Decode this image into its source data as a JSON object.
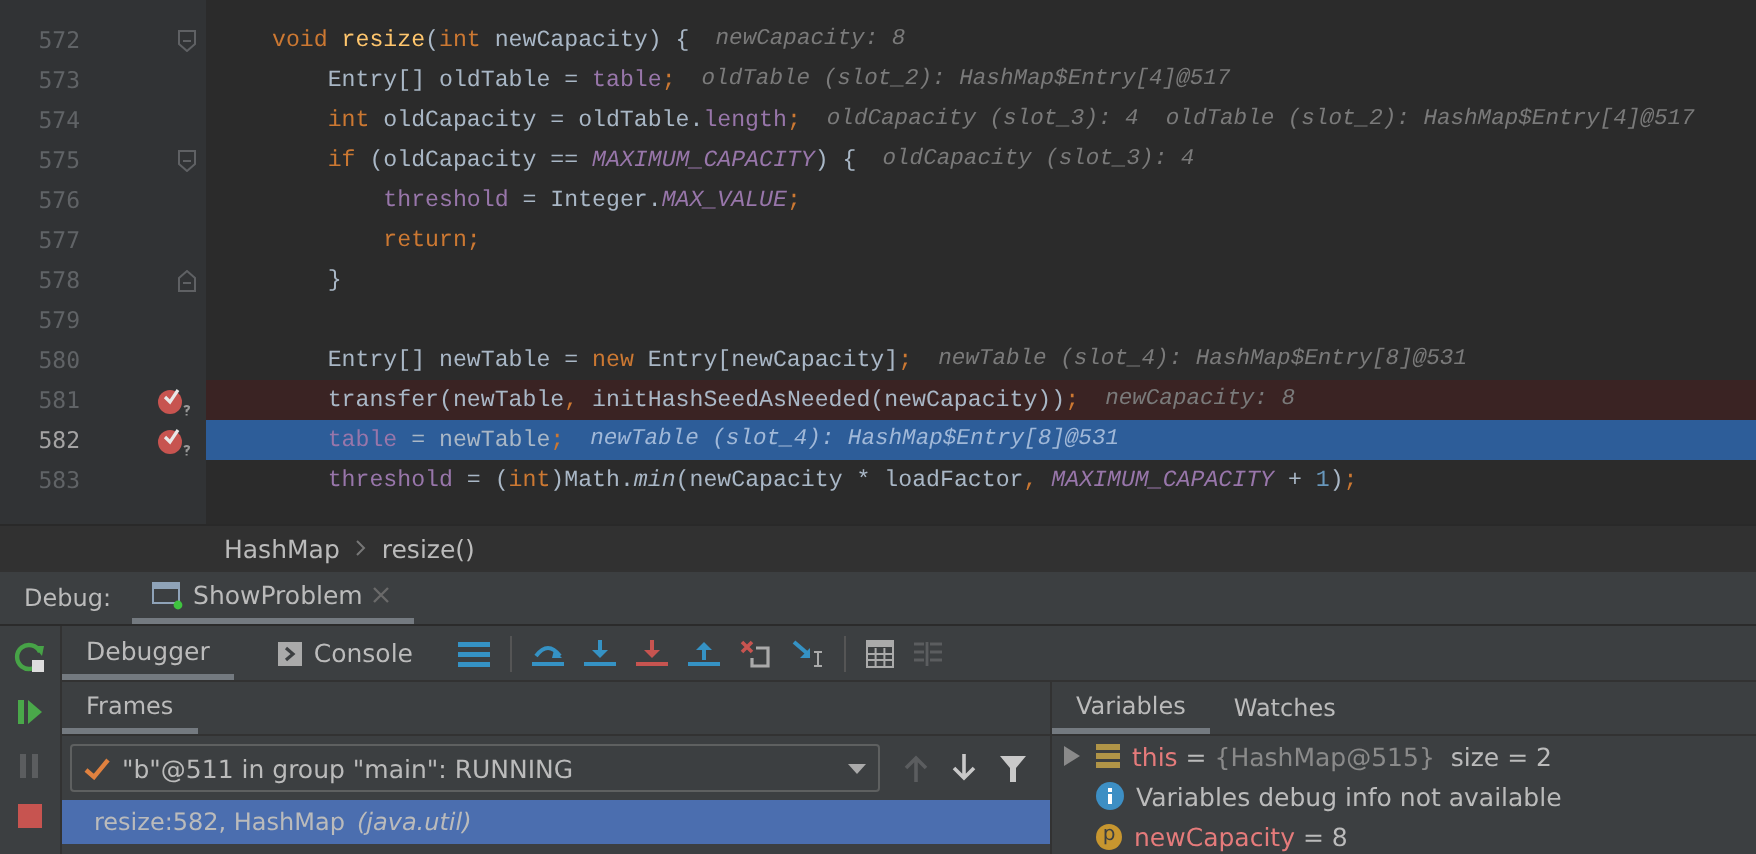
{
  "editor": {
    "lines": [
      {
        "number": "572",
        "fold_start": true,
        "fold_end": false,
        "breakpoint": false,
        "execution_point": false,
        "tokens": [
          {
            "kind": "kw",
            "text": "void"
          },
          {
            "kind": "decl",
            "text": " resize"
          },
          {
            "kind": "plain",
            "text": "("
          },
          {
            "kind": "kw",
            "text": "int"
          },
          {
            "kind": "plain",
            "text": " newCapacity) {"
          }
        ],
        "hint": "newCapacity: 8"
      },
      {
        "number": "573",
        "fold_start": false,
        "fold_end": false,
        "breakpoint": false,
        "execution_point": false,
        "tokens": [
          {
            "kind": "plain",
            "text": "    Entry[] oldTable = "
          },
          {
            "kind": "field",
            "text": "table"
          },
          {
            "kind": "kw",
            "text": ";"
          }
        ],
        "hint": "oldTable (slot_2): HashMap$Entry[4]@517"
      },
      {
        "number": "574",
        "fold_start": false,
        "fold_end": false,
        "breakpoint": false,
        "execution_point": false,
        "tokens": [
          {
            "kind": "kw",
            "text": "    int"
          },
          {
            "kind": "plain",
            "text": " oldCapacity = oldTable."
          },
          {
            "kind": "field",
            "text": "length"
          },
          {
            "kind": "kw",
            "text": ";"
          }
        ],
        "hint": "oldCapacity (slot_3): 4  oldTable (slot_2): HashMap$Entry[4]@517"
      },
      {
        "number": "575",
        "fold_start": true,
        "fold_end": false,
        "breakpoint": false,
        "execution_point": false,
        "tokens": [
          {
            "kind": "kw",
            "text": "    if"
          },
          {
            "kind": "plain",
            "text": " (oldCapacity == "
          },
          {
            "kind": "static",
            "text": "MAXIMUM_CAPACITY"
          },
          {
            "kind": "plain",
            "text": ") {"
          }
        ],
        "hint": "oldCapacity (slot_3): 4"
      },
      {
        "number": "576",
        "fold_start": false,
        "fold_end": false,
        "breakpoint": false,
        "execution_point": false,
        "tokens": [
          {
            "kind": "field",
            "text": "        threshold"
          },
          {
            "kind": "plain",
            "text": " = Integer."
          },
          {
            "kind": "static",
            "text": "MAX_VALUE"
          },
          {
            "kind": "kw",
            "text": ";"
          }
        ]
      },
      {
        "number": "577",
        "fold_start": false,
        "fold_end": false,
        "breakpoint": false,
        "execution_point": false,
        "tokens": [
          {
            "kind": "kw",
            "text": "        return;"
          }
        ]
      },
      {
        "number": "578",
        "fold_start": false,
        "fold_end": true,
        "breakpoint": false,
        "execution_point": false,
        "tokens": [
          {
            "kind": "plain",
            "text": "    }"
          }
        ]
      },
      {
        "number": "579",
        "fold_start": false,
        "fold_end": false,
        "breakpoint": false,
        "execution_point": false
      },
      {
        "number": "580",
        "fold_start": false,
        "fold_end": false,
        "breakpoint": false,
        "execution_point": false,
        "tokens": [
          {
            "kind": "plain",
            "text": "    Entry[] newTable = "
          },
          {
            "kind": "kw",
            "text": "new"
          },
          {
            "kind": "plain",
            "text": " Entry[newCapacity]"
          },
          {
            "kind": "kw",
            "text": ";"
          }
        ],
        "hint": "newTable (slot_4): HashMap$Entry[8]@531"
      },
      {
        "number": "581",
        "fold_start": false,
        "fold_end": false,
        "breakpoint": true,
        "execution_point": false,
        "tokens": [
          {
            "kind": "plain",
            "text": "    transfer(newTable"
          },
          {
            "kind": "kw",
            "text": ","
          },
          {
            "kind": "plain",
            "text": " initHashSeedAsNeeded(newCapacity))"
          },
          {
            "kind": "kw",
            "text": ";"
          }
        ],
        "hint": "newCapacity: 8"
      },
      {
        "number": "582",
        "fold_start": false,
        "fold_end": false,
        "breakpoint": true,
        "execution_point": true,
        "tokens": [
          {
            "kind": "field",
            "text": "    table"
          },
          {
            "kind": "plain",
            "text": " = newTable"
          },
          {
            "kind": "kw",
            "text": ";"
          }
        ],
        "hint": "newTable (slot_4): HashMap$Entry[8]@531"
      },
      {
        "number": "583",
        "fold_start": false,
        "fold_end": false,
        "breakpoint": false,
        "execution_point": false,
        "tokens": [
          {
            "kind": "field",
            "text": "    threshold"
          },
          {
            "kind": "plain",
            "text": " = ("
          },
          {
            "kind": "kw",
            "text": "int"
          },
          {
            "kind": "plain",
            "text": ")Math."
          },
          {
            "kind": "method",
            "text": "min"
          },
          {
            "kind": "plain",
            "text": "(newCapacity * loadFactor"
          },
          {
            "kind": "kw",
            "text": ","
          },
          {
            "kind": "static",
            "text": " MAXIMUM_CAPACITY"
          },
          {
            "kind": "plain",
            "text": " + "
          },
          {
            "kind": "num",
            "text": "1"
          },
          {
            "kind": "plain",
            "text": ")"
          },
          {
            "kind": "kw",
            "text": ";"
          }
        ]
      }
    ]
  },
  "breadcrumb": [
    {
      "text": "HashMap"
    },
    {
      "text": "resize()"
    }
  ],
  "debug_bar": {
    "label": "Debug:",
    "tabs": [
      {
        "label": "ShowProblem",
        "selected": true
      }
    ]
  },
  "debugger_tabs": [
    {
      "label": "Debugger",
      "selected": true
    },
    {
      "label": "Console",
      "selected": false
    }
  ],
  "frames": {
    "tabs": [
      {
        "label": "Frames",
        "selected": true
      }
    ],
    "thread": {
      "value": "\"b\"@511 in group \"main\": RUNNING"
    },
    "items": [
      {
        "method": "resize:582, HashMap",
        "package": "(java.util)",
        "selected": true
      }
    ]
  },
  "variables": {
    "tabs": [
      {
        "label": "Variables",
        "selected": true
      },
      {
        "label": "Watches",
        "selected": false
      }
    ],
    "items": [
      {
        "kind": "object",
        "name": "this",
        "value": "=",
        "ref": "{HashMap@515}",
        "extra": "size = 2",
        "expanded": false
      },
      {
        "kind": "info",
        "text": "Variables debug info not available"
      },
      {
        "kind": "param",
        "badge": "p",
        "name": "newCapacity",
        "value": "= 8"
      }
    ]
  }
}
